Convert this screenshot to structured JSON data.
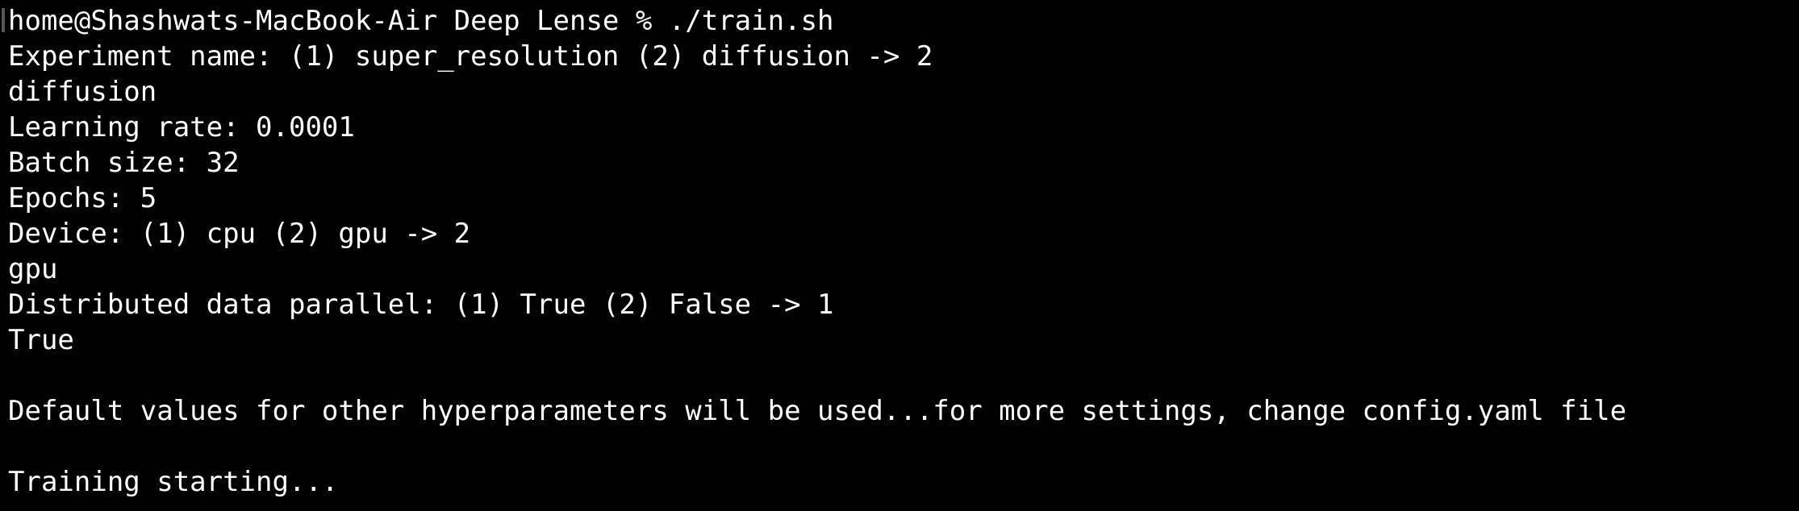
{
  "terminal": {
    "lines": [
      "home@Shashwats-MacBook-Air Deep Lense % ./train.sh",
      "Experiment name: (1) super_resolution (2) diffusion -> 2",
      "diffusion",
      "Learning rate: 0.0001",
      "Batch size: 32",
      "Epochs: 5",
      "Device: (1) cpu (2) gpu -> 2",
      "gpu",
      "Distributed data parallel: (1) True (2) False -> 1",
      "True",
      "",
      "Default values for other hyperparameters will be used...for more settings, change config.yaml file",
      "",
      "Training starting..."
    ]
  },
  "colors": {
    "background": "#000000",
    "text": "#ffffff"
  }
}
